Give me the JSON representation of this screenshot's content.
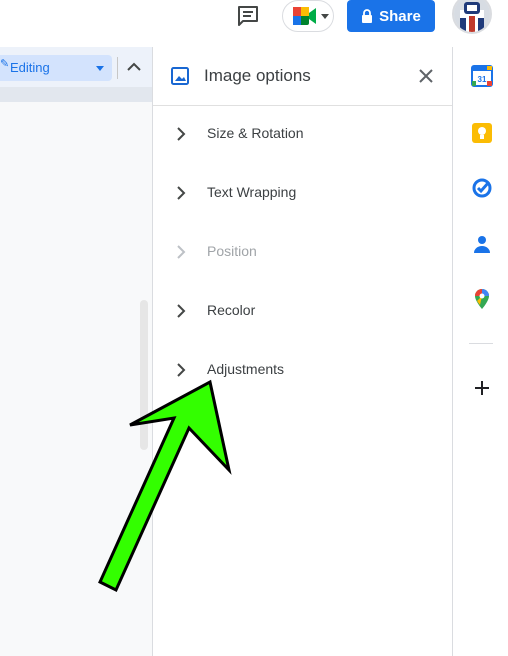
{
  "header": {
    "share_label": "Share",
    "icons": [
      "comment-icon",
      "meet-icon",
      "lock-icon",
      "avatar"
    ]
  },
  "toolbar": {
    "mode_label": "Editing"
  },
  "panel": {
    "title": "Image options",
    "sections": [
      {
        "label": "Size & Rotation",
        "enabled": true
      },
      {
        "label": "Text Wrapping",
        "enabled": true
      },
      {
        "label": "Position",
        "enabled": false
      },
      {
        "label": "Recolor",
        "enabled": true
      },
      {
        "label": "Adjustments",
        "enabled": true
      }
    ]
  },
  "rail": {
    "calendar_day": "31",
    "apps": [
      "calendar-icon",
      "keep-icon",
      "tasks-icon",
      "contacts-icon",
      "maps-icon",
      "add-icon"
    ]
  },
  "colors": {
    "share_blue": "#1a73e8",
    "arrow_green": "#33ff00",
    "keep_yellow": "#fbbc04"
  }
}
